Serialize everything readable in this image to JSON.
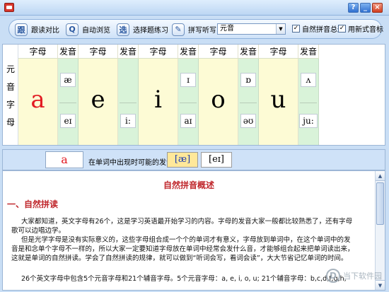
{
  "window": {
    "min": "_",
    "max": "□",
    "close": "×",
    "help": "?"
  },
  "toolbar": {
    "buttons": [
      {
        "label": "跟读对比",
        "icon": "跟"
      },
      {
        "label": "自动浏览",
        "icon": "Q"
      },
      {
        "label": "选择题练习",
        "icon": "选"
      },
      {
        "label": "拼写听写",
        "icon": "✎"
      }
    ],
    "select": {
      "value": "元音"
    },
    "checks": [
      {
        "label": "自然拼音总述",
        "checked": "✓"
      },
      {
        "label": "用新式音标",
        "checked": "✓"
      }
    ]
  },
  "grid": {
    "row_label": [
      "元",
      "音",
      "字",
      "母"
    ],
    "header_letter": "字母",
    "header_sound": "发音",
    "columns": [
      {
        "letter": "a",
        "letter_color": "#e21b23",
        "sounds": [
          "æ",
          "eɪ"
        ]
      },
      {
        "letter": "e",
        "letter_color": "#000000",
        "sounds": [
          "i:"
        ]
      },
      {
        "letter": "i",
        "letter_color": "#000000",
        "sounds": [
          "ɪ",
          "aɪ"
        ]
      },
      {
        "letter": "o",
        "letter_color": "#000000",
        "sounds": [
          "ɒ",
          "əʊ"
        ]
      },
      {
        "letter": "u",
        "letter_color": "#000000",
        "sounds": [
          "ʌ",
          "ju:"
        ]
      }
    ]
  },
  "status": {
    "current_letter": "a",
    "prompt": "在单词中出现时可能的发音：",
    "sounds": [
      "[æ]",
      "[eɪ]"
    ]
  },
  "doc": {
    "title": "自然拼音概述",
    "section": "一、自然拼读",
    "paragraphs": [
      "大家都知道，英文字母有26个，这是学习英语最开始学习的内容。字母的发音大家一般都比较熟悉了，还有字母",
      "歌可以边唱边学。",
      "但是光学字母是没有实际意义的，这些字母组合成一个个的单词才有意义，字母放到单词中，在这个单词中的发",
      "音是和念单个字母不一样的，所以大家一定要知道字母放在单词中经常会发什么音，才能够组合起来把单词读出来，",
      "这就是单词的自然拼读。学会了自然拼读的规律，就可以做到“听词会写，看词会读”，大大节省记忆单词的时间。",
      "26个英文字母中包含5个元音字母和21个辅音字母。5个元音字母：a, e, i, o, u; 21个辅音字母：b,c,d,f,g,h,"
    ],
    "watermark": "当下软件园"
  }
}
